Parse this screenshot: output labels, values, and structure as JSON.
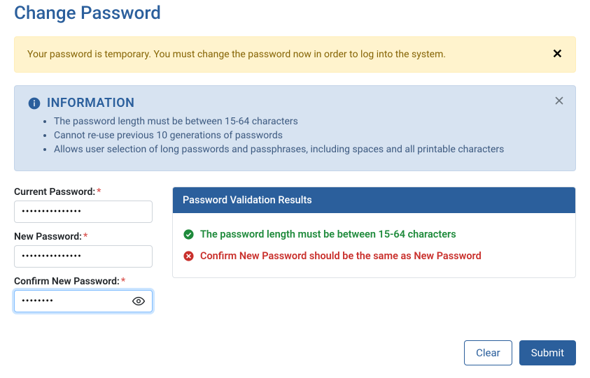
{
  "title": "Change Password",
  "warning": {
    "text": "Your password is temporary. You must change the password now in order to log into the system."
  },
  "info_panel": {
    "heading": "INFORMATION",
    "items": [
      "The password length must be between 15-64 characters",
      "Cannot re-use previous 10 generations of passwords",
      "Allows user selection of long passwords and passphrases, including spaces and all printable characters"
    ]
  },
  "form": {
    "current": {
      "label": "Current Password:",
      "value": "•••••••••••••••"
    },
    "newpw": {
      "label": "New Password:",
      "value": "•••••••••••••••"
    },
    "confirm": {
      "label": "Confirm New Password:",
      "value": "••••••••"
    }
  },
  "validation": {
    "header": "Password Validation Results",
    "ok": "The password length must be between 15-64 characters",
    "err": "Confirm New Password should be the same as New Password"
  },
  "actions": {
    "clear": "Clear",
    "submit": "Submit"
  }
}
